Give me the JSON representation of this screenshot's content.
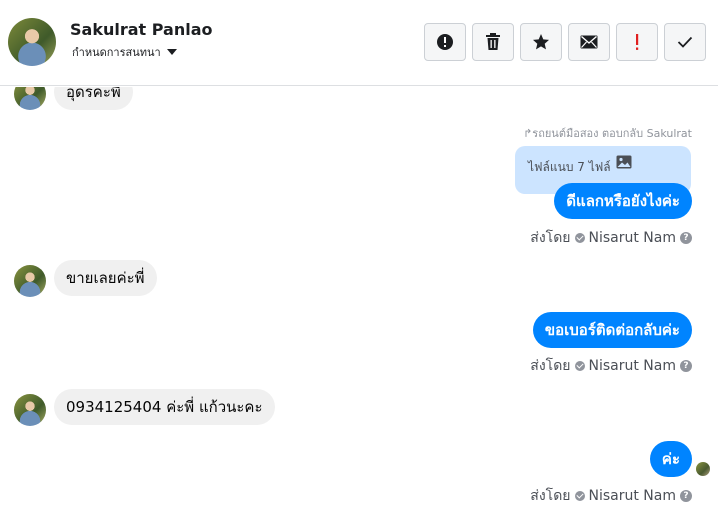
{
  "header": {
    "contact_name": "Sakulrat Panlao",
    "assign_label": "กำหนดการสนทนา"
  },
  "toolbar": {
    "buttons": [
      {
        "name": "spam",
        "icon": "alert-circle-icon"
      },
      {
        "name": "delete",
        "icon": "trash-icon"
      },
      {
        "name": "star",
        "icon": "star-icon"
      },
      {
        "name": "unread",
        "icon": "envelope-icon"
      },
      {
        "name": "follow-up",
        "icon": "exclamation-icon",
        "color": "#e02020"
      },
      {
        "name": "done",
        "icon": "check-icon"
      }
    ]
  },
  "messages": {
    "incoming_top": "อุดรคะพี",
    "reply_note": "รถยนต์มือสอง ตอบกลับ Sakulrat",
    "attachment_label": "ไฟล์แนบ 7 ไฟล์",
    "out_1": "ดีแลกหรือยังไงค่ะ",
    "in_1": "ขายเลยค่ะพี่",
    "out_2": "ขอเบอร์ติดต่อกลับค่ะ",
    "in_2": "0934125404 ค่ะพี่ แก้วนะคะ",
    "out_3": "ค่ะ"
  },
  "sent_by": {
    "prefix": "ส่งโดย",
    "agent": "Nisarut Nam"
  },
  "colors": {
    "outgoing_bubble": "#0084ff",
    "incoming_bubble": "#f0f0f0",
    "attachment_box": "#cce4ff"
  }
}
